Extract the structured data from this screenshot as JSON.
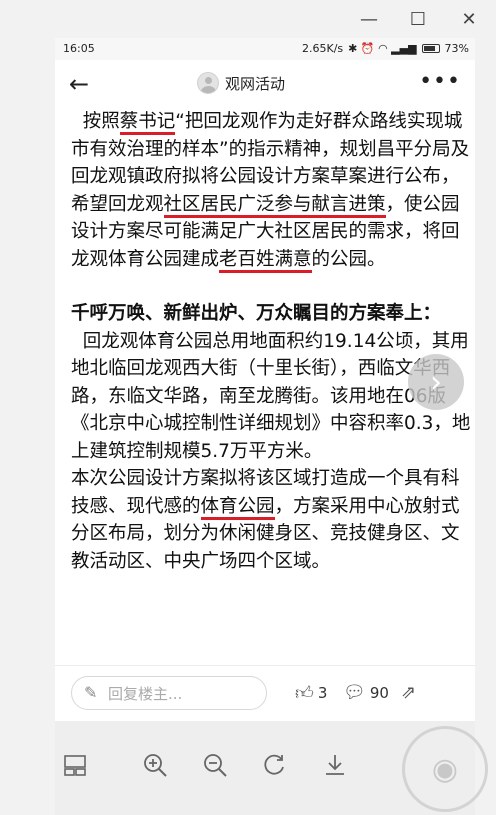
{
  "window": {
    "minimize": "—",
    "maximize": "☐",
    "close": "✕"
  },
  "status": {
    "time": "16:05",
    "speed": "2.65K/s",
    "icons": "✱ ⏰ ◠ ▂▄▆",
    "battery": "73%"
  },
  "header": {
    "title": "观网活动",
    "back": "←",
    "more": "•••"
  },
  "article": {
    "p1": [
      {
        "t": "  按照"
      },
      {
        "t": "蔡书记",
        "hl": true
      },
      {
        "t": "“把回龙观作为走好群众路线实现城市有效治理的样本”的指示精神，规划昌平分局及回龙观镇政府拟将公园设计方案草案进行公布，希望回龙观"
      },
      {
        "t": "社区居民广泛参与献言进策",
        "hl": true
      },
      {
        "t": "，使公园设计方案尽可能满足广大社区居民的需求，将回龙观体育公园建成"
      },
      {
        "t": "老百姓满意",
        "hl": true
      },
      {
        "t": "的公园。"
      }
    ],
    "heading": "千呼万唤、新鲜出炉、万众瞩目的方案奉上：",
    "p2": "  回龙观体育公园总用地面积约19.14公顷，其用地北临回龙观西大街（十里长街），西临文华西路，东临文华路，南至龙腾街。该用地在06版《北京中心城控制性详细规划》中容积率0.3，地上建筑控制规模5.7万平方米。",
    "p3": [
      {
        "t": "本次公园设计方案拟将该区域打造成一个具有科技感、现代感的"
      },
      {
        "t": "体育公园",
        "hl": true
      },
      {
        "t": "，方案采用中心放射式分区布局，划分为休闲健身区、竞技健身区、文教活动区、中央广场四个区域。"
      }
    ]
  },
  "comment_bar": {
    "placeholder": "回复楼主...",
    "likes": "3",
    "comments": "90"
  },
  "bottom_toolbar": [
    "layout-icon",
    "zoom-in-icon",
    "zoom-out-icon",
    "rotate-icon",
    "download-icon"
  ],
  "colors": {
    "highlight": "#d91e2a"
  }
}
